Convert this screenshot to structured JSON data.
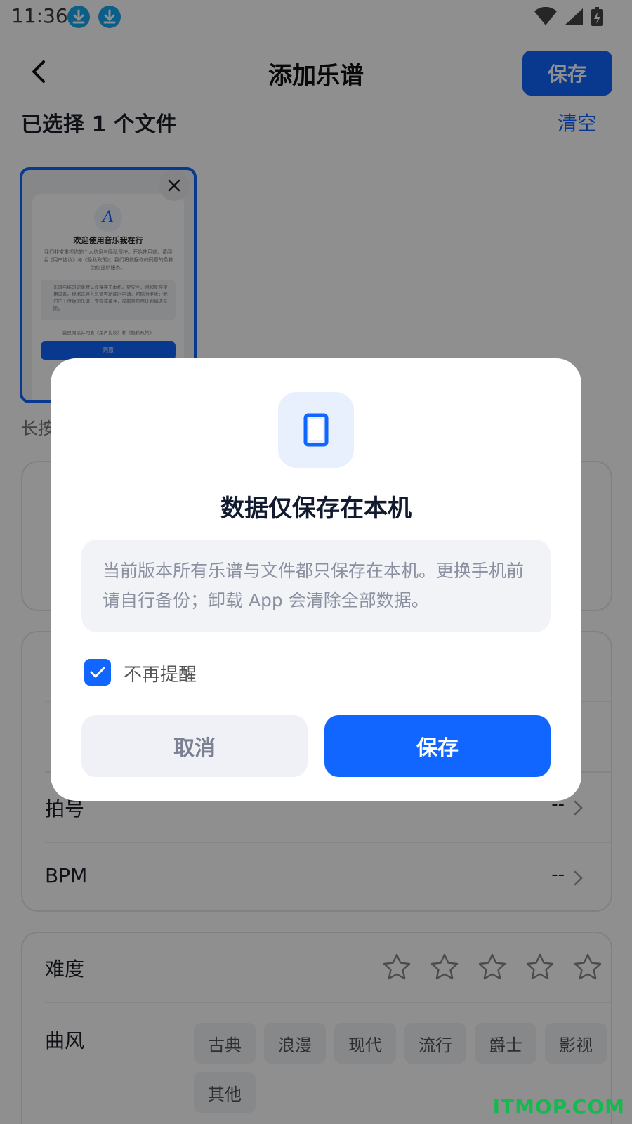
{
  "status_bar": {
    "time": "11:36"
  },
  "header": {
    "title": "添加乐谱",
    "save_label": "保存"
  },
  "selection": {
    "count_text": "已选择 1 个文件",
    "clear_label": "清空"
  },
  "thumbnail": {
    "logo_letter": "A",
    "title": "欢迎使用音乐我在行",
    "intro": "我们非常重视你的个人信息与隐私保护。开始使用前，请阅读《用户协议》与《隐私政策》；我们将依据你的同意的条款为你提供服务。",
    "notice": "乐谱与练习记录默认仅保存于本机。更安全，得和反在使用设备。根据选导入乐谱等功能时申请。可随时拒绝；我们不上传你的乐谱，宜提或备注，仅前意见然计划编语音阶。",
    "agree_line": "我已阅读并同意《用户协议》和《隐私政策》",
    "agree_button": "同意"
  },
  "hint": "长按",
  "form": {
    "time_signature_label": "拍号",
    "time_signature_value": "--",
    "bpm_label": "BPM",
    "bpm_value": "--",
    "difficulty_label": "难度",
    "difficulty_rating": 0,
    "difficulty_max": 5,
    "style_label": "曲风",
    "style_tags": [
      "古典",
      "浪漫",
      "现代",
      "流行",
      "爵士",
      "影视",
      "其他"
    ]
  },
  "dialog": {
    "icon": "phone-icon",
    "title": "数据仅保存在本机",
    "message": "当前版本所有乐谱与文件都只保存在本机。更换手机前请自行备份；卸载 App 会清除全部数据。",
    "checkbox_label": "不再提醒",
    "checkbox_checked": true,
    "cancel_label": "取消",
    "confirm_label": "保存"
  },
  "watermark": "ITMOP.COM",
  "colors": {
    "accent": "#1166ff",
    "overlay": "rgba(0,0,0,0.44)",
    "download_icon": "#18a8f0",
    "watermark": "#16b84f"
  }
}
